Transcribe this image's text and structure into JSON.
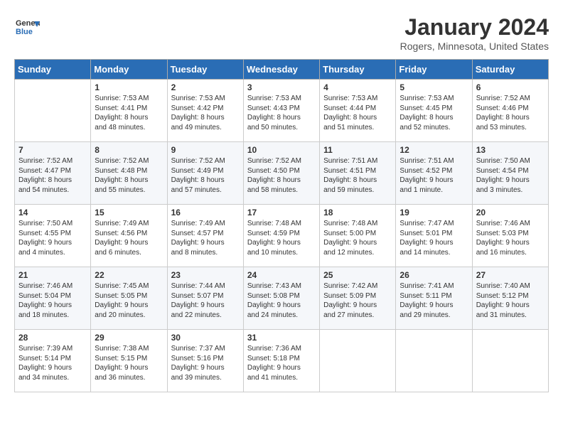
{
  "header": {
    "logo_line1": "General",
    "logo_line2": "Blue",
    "title": "January 2024",
    "subtitle": "Rogers, Minnesota, United States"
  },
  "days_of_week": [
    "Sunday",
    "Monday",
    "Tuesday",
    "Wednesday",
    "Thursday",
    "Friday",
    "Saturday"
  ],
  "weeks": [
    [
      {
        "day": "",
        "content": ""
      },
      {
        "day": "1",
        "content": "Sunrise: 7:53 AM\nSunset: 4:41 PM\nDaylight: 8 hours\nand 48 minutes."
      },
      {
        "day": "2",
        "content": "Sunrise: 7:53 AM\nSunset: 4:42 PM\nDaylight: 8 hours\nand 49 minutes."
      },
      {
        "day": "3",
        "content": "Sunrise: 7:53 AM\nSunset: 4:43 PM\nDaylight: 8 hours\nand 50 minutes."
      },
      {
        "day": "4",
        "content": "Sunrise: 7:53 AM\nSunset: 4:44 PM\nDaylight: 8 hours\nand 51 minutes."
      },
      {
        "day": "5",
        "content": "Sunrise: 7:53 AM\nSunset: 4:45 PM\nDaylight: 8 hours\nand 52 minutes."
      },
      {
        "day": "6",
        "content": "Sunrise: 7:52 AM\nSunset: 4:46 PM\nDaylight: 8 hours\nand 53 minutes."
      }
    ],
    [
      {
        "day": "7",
        "content": "Sunrise: 7:52 AM\nSunset: 4:47 PM\nDaylight: 8 hours\nand 54 minutes."
      },
      {
        "day": "8",
        "content": "Sunrise: 7:52 AM\nSunset: 4:48 PM\nDaylight: 8 hours\nand 55 minutes."
      },
      {
        "day": "9",
        "content": "Sunrise: 7:52 AM\nSunset: 4:49 PM\nDaylight: 8 hours\nand 57 minutes."
      },
      {
        "day": "10",
        "content": "Sunrise: 7:52 AM\nSunset: 4:50 PM\nDaylight: 8 hours\nand 58 minutes."
      },
      {
        "day": "11",
        "content": "Sunrise: 7:51 AM\nSunset: 4:51 PM\nDaylight: 8 hours\nand 59 minutes."
      },
      {
        "day": "12",
        "content": "Sunrise: 7:51 AM\nSunset: 4:52 PM\nDaylight: 9 hours\nand 1 minute."
      },
      {
        "day": "13",
        "content": "Sunrise: 7:50 AM\nSunset: 4:54 PM\nDaylight: 9 hours\nand 3 minutes."
      }
    ],
    [
      {
        "day": "14",
        "content": "Sunrise: 7:50 AM\nSunset: 4:55 PM\nDaylight: 9 hours\nand 4 minutes."
      },
      {
        "day": "15",
        "content": "Sunrise: 7:49 AM\nSunset: 4:56 PM\nDaylight: 9 hours\nand 6 minutes."
      },
      {
        "day": "16",
        "content": "Sunrise: 7:49 AM\nSunset: 4:57 PM\nDaylight: 9 hours\nand 8 minutes."
      },
      {
        "day": "17",
        "content": "Sunrise: 7:48 AM\nSunset: 4:59 PM\nDaylight: 9 hours\nand 10 minutes."
      },
      {
        "day": "18",
        "content": "Sunrise: 7:48 AM\nSunset: 5:00 PM\nDaylight: 9 hours\nand 12 minutes."
      },
      {
        "day": "19",
        "content": "Sunrise: 7:47 AM\nSunset: 5:01 PM\nDaylight: 9 hours\nand 14 minutes."
      },
      {
        "day": "20",
        "content": "Sunrise: 7:46 AM\nSunset: 5:03 PM\nDaylight: 9 hours\nand 16 minutes."
      }
    ],
    [
      {
        "day": "21",
        "content": "Sunrise: 7:46 AM\nSunset: 5:04 PM\nDaylight: 9 hours\nand 18 minutes."
      },
      {
        "day": "22",
        "content": "Sunrise: 7:45 AM\nSunset: 5:05 PM\nDaylight: 9 hours\nand 20 minutes."
      },
      {
        "day": "23",
        "content": "Sunrise: 7:44 AM\nSunset: 5:07 PM\nDaylight: 9 hours\nand 22 minutes."
      },
      {
        "day": "24",
        "content": "Sunrise: 7:43 AM\nSunset: 5:08 PM\nDaylight: 9 hours\nand 24 minutes."
      },
      {
        "day": "25",
        "content": "Sunrise: 7:42 AM\nSunset: 5:09 PM\nDaylight: 9 hours\nand 27 minutes."
      },
      {
        "day": "26",
        "content": "Sunrise: 7:41 AM\nSunset: 5:11 PM\nDaylight: 9 hours\nand 29 minutes."
      },
      {
        "day": "27",
        "content": "Sunrise: 7:40 AM\nSunset: 5:12 PM\nDaylight: 9 hours\nand 31 minutes."
      }
    ],
    [
      {
        "day": "28",
        "content": "Sunrise: 7:39 AM\nSunset: 5:14 PM\nDaylight: 9 hours\nand 34 minutes."
      },
      {
        "day": "29",
        "content": "Sunrise: 7:38 AM\nSunset: 5:15 PM\nDaylight: 9 hours\nand 36 minutes."
      },
      {
        "day": "30",
        "content": "Sunrise: 7:37 AM\nSunset: 5:16 PM\nDaylight: 9 hours\nand 39 minutes."
      },
      {
        "day": "31",
        "content": "Sunrise: 7:36 AM\nSunset: 5:18 PM\nDaylight: 9 hours\nand 41 minutes."
      },
      {
        "day": "",
        "content": ""
      },
      {
        "day": "",
        "content": ""
      },
      {
        "day": "",
        "content": ""
      }
    ]
  ]
}
